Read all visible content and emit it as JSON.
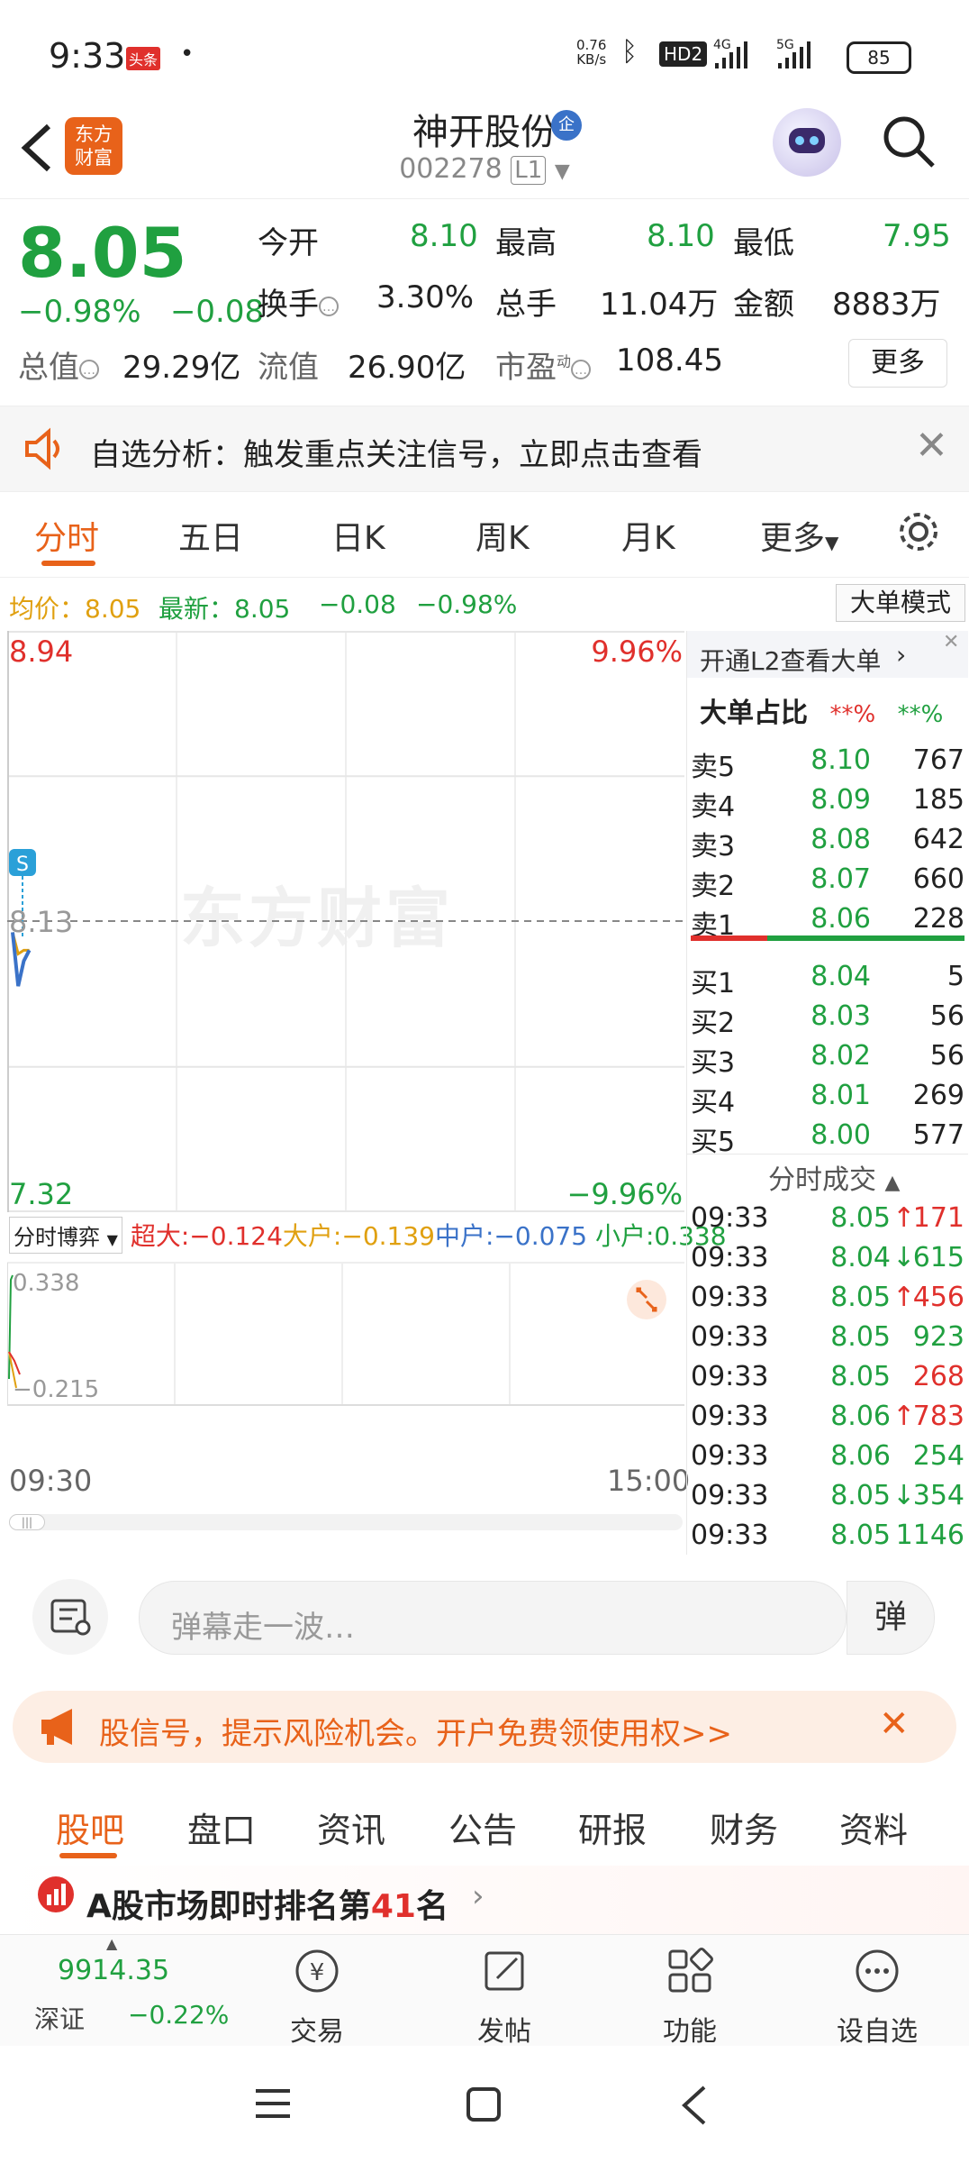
{
  "status_bar": {
    "time": "9:33",
    "badge": "头条",
    "net_speed": "0.76",
    "net_unit": "KB/s",
    "signals": "HD2 4G 5G",
    "battery": "85"
  },
  "header": {
    "logo_text_1": "东方",
    "logo_text_2": "财富",
    "stock_name": "神开股份",
    "badge": "企",
    "stock_code": "002278",
    "level": "L1"
  },
  "quote": {
    "price": "8.05",
    "change_pct": "−0.98%",
    "change": "−0.08",
    "open_label": "今开",
    "open": "8.10",
    "high_label": "最高",
    "high": "8.10",
    "low_label": "最低",
    "low": "7.95",
    "turnover_label": "换手",
    "turnover": "3.30%",
    "volume_label": "总手",
    "volume": "11.04万",
    "amount_label": "金额",
    "amount": "8883万",
    "mktcap_label": "总值",
    "mktcap": "29.29亿",
    "float_label": "流值",
    "float": "26.90亿",
    "pe_label": "市盈",
    "pe_sup": "动",
    "pe": "108.45",
    "more": "更多"
  },
  "notice": {
    "text": "自选分析：触发重点关注信号，立即点击查看"
  },
  "chart_tabs": [
    "分时",
    "五日",
    "日K",
    "周K",
    "月K",
    "更多"
  ],
  "avg_line": {
    "avg_label": "均价：",
    "avg": "8.05",
    "latest_label": "最新：",
    "latest": "8.05",
    "change": "−0.08",
    "pct": "−0.98%",
    "mode_button": "大单模式"
  },
  "chart_data": {
    "type": "line",
    "y_top": "8.94",
    "y_bottom": "7.32",
    "y_mid": "8.13",
    "pct_top": "9.96%",
    "pct_bottom": "−9.96%",
    "x_start": "09:30",
    "x_end": "15:00",
    "ylim": [
      7.32,
      8.94
    ],
    "prev_close": 8.13,
    "x": [
      "09:30",
      "09:31",
      "09:32",
      "09:33"
    ],
    "price": [
      8.1,
      7.95,
      8.02,
      8.05
    ],
    "avg": [
      8.1,
      8.04,
      8.05,
      8.05
    ],
    "watermark": "东方财富",
    "marker": "S"
  },
  "flow": {
    "select": "分时博弈",
    "super_label": "超大:",
    "super": "−0.124",
    "large_label": "大户:",
    "large": "−0.139",
    "mid_label": "中户:",
    "mid": "−0.075",
    "small_label": "小户:",
    "small": "0.338",
    "ymax": "0.338",
    "ymin": "−0.215"
  },
  "right_panel": {
    "l2_link": "开通L2查看大单",
    "big_ratio_label": "大单占比",
    "big_ratio_red": "**%",
    "big_ratio_green": "**%",
    "sells": [
      {
        "label": "卖5",
        "price": "8.10",
        "vol": "767"
      },
      {
        "label": "卖4",
        "price": "8.09",
        "vol": "185"
      },
      {
        "label": "卖3",
        "price": "8.08",
        "vol": "642"
      },
      {
        "label": "卖2",
        "price": "8.07",
        "vol": "660"
      },
      {
        "label": "卖1",
        "price": "8.06",
        "vol": "228"
      }
    ],
    "buys": [
      {
        "label": "买1",
        "price": "8.04",
        "vol": "5"
      },
      {
        "label": "买2",
        "price": "8.03",
        "vol": "56"
      },
      {
        "label": "买3",
        "price": "8.02",
        "vol": "56"
      },
      {
        "label": "买4",
        "price": "8.01",
        "vol": "269"
      },
      {
        "label": "买5",
        "price": "8.00",
        "vol": "577"
      }
    ],
    "trades_title": "分时成交",
    "trades": [
      {
        "time": "09:33",
        "price": "8.05",
        "arrow": "↑",
        "vol": "171",
        "color": "#e0302c"
      },
      {
        "time": "09:33",
        "price": "8.04",
        "arrow": "↓",
        "vol": "615",
        "color": "#20a040"
      },
      {
        "time": "09:33",
        "price": "8.05",
        "arrow": "↑",
        "vol": "456",
        "color": "#e0302c"
      },
      {
        "time": "09:33",
        "price": "8.05",
        "arrow": "",
        "vol": "923",
        "color": "#20a040"
      },
      {
        "time": "09:33",
        "price": "8.05",
        "arrow": "",
        "vol": "268",
        "color": "#e0302c"
      },
      {
        "time": "09:33",
        "price": "8.06",
        "arrow": "↑",
        "vol": "783",
        "color": "#e0302c"
      },
      {
        "time": "09:33",
        "price": "8.06",
        "arrow": "",
        "vol": "254",
        "color": "#20a040"
      },
      {
        "time": "09:33",
        "price": "8.05",
        "arrow": "↓",
        "vol": "354",
        "color": "#20a040"
      },
      {
        "time": "09:33",
        "price": "8.05",
        "arrow": "",
        "vol": "1146",
        "color": "#20a040"
      }
    ]
  },
  "comment": {
    "placeholder": "弹幕走一波…",
    "danmu": "弹"
  },
  "banner": {
    "text": "股信号，提示风险机会。开户免费领使用权>>"
  },
  "bottom_tabs": [
    "股吧",
    "盘口",
    "资讯",
    "公告",
    "研报",
    "财务",
    "资料"
  ],
  "ranking": {
    "prefix": "A股市场即时排名第",
    "rank": "41",
    "suffix": "名"
  },
  "bottom_nav": {
    "index_value": "9914.35",
    "index_name": "深证",
    "index_change": "−0.22%",
    "items": [
      "交易",
      "发帖",
      "功能",
      "设自选"
    ]
  },
  "colors": {
    "up": "#e0302c",
    "down": "#20a040",
    "accent": "#e8621a",
    "avg": "#e0a010",
    "price_line": "#3a72c8"
  }
}
